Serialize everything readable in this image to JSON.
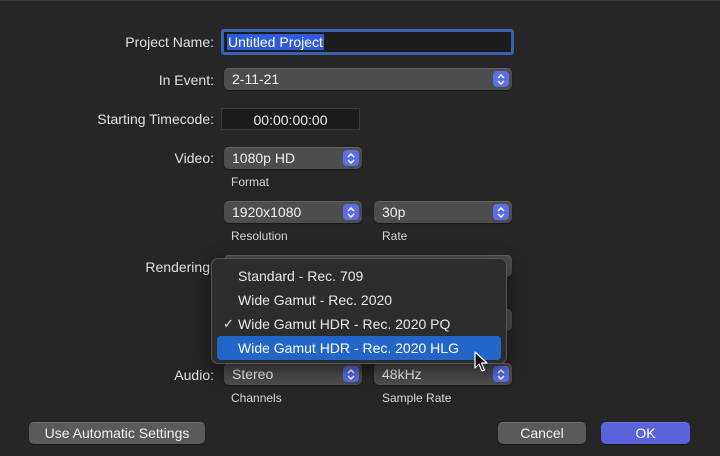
{
  "form": {
    "project_name_label": "Project Name:",
    "project_name_value": "Untitled Project",
    "in_event_label": "In Event:",
    "in_event_value": "2-11-21",
    "starting_timecode_label": "Starting Timecode:",
    "starting_timecode_value": "00:00:00:00",
    "video_label": "Video:",
    "format_value": "1080p HD",
    "format_caption": "Format",
    "resolution_value": "1920x1080",
    "resolution_caption": "Resolution",
    "rate_value": "30p",
    "rate_caption": "Rate",
    "rendering_label": "Rendering",
    "audio_label": "Audio:",
    "channels_value": "Stereo",
    "channels_caption": "Channels",
    "sample_rate_value": "48kHz",
    "sample_rate_caption": "Sample Rate"
  },
  "color_space_menu": {
    "items": [
      {
        "label": "Standard - Rec. 709",
        "checked": false,
        "highlighted": false
      },
      {
        "label": "Wide Gamut - Rec. 2020",
        "checked": false,
        "highlighted": false
      },
      {
        "label": "Wide Gamut HDR - Rec. 2020 PQ",
        "checked": true,
        "highlighted": false
      },
      {
        "label": "Wide Gamut HDR - Rec. 2020 HLG",
        "checked": false,
        "highlighted": true
      }
    ],
    "check_glyph": "✓"
  },
  "buttons": {
    "use_automatic": "Use Automatic Settings",
    "cancel": "Cancel",
    "ok": "OK"
  },
  "colors": {
    "accent": "#5b63d9",
    "highlight": "#2166c8",
    "selection": "#2f5bd6"
  },
  "icons": {
    "popup_stepper": "up-down-chevron-icon",
    "cursor": "arrow-cursor-icon"
  }
}
